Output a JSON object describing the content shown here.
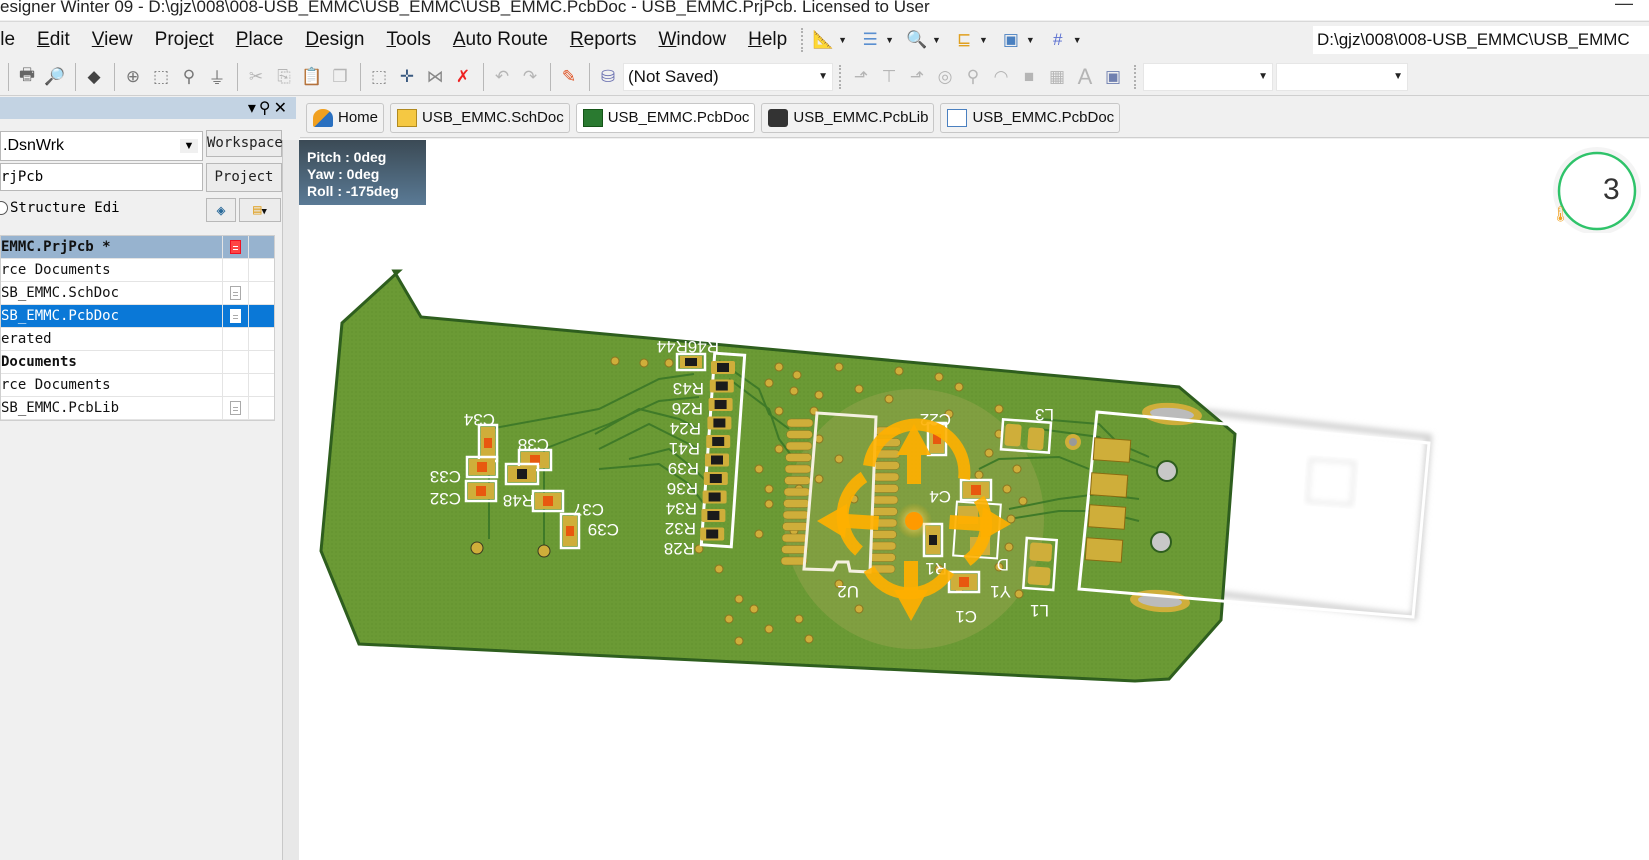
{
  "window": {
    "title": "esigner Winter 09 - D:\\gjz\\008\\008-USB_EMMC\\USB_EMMC\\USB_EMMC.PcbDoc - USB_EMMC.PrjPcb. Licensed to User",
    "minimize_glyph": "—"
  },
  "menu": {
    "items": [
      {
        "label": "ile",
        "underline": ""
      },
      {
        "label": "Edit",
        "underline": "E"
      },
      {
        "label": "View",
        "underline": "V"
      },
      {
        "label": "Project",
        "underline": "c"
      },
      {
        "label": "Place",
        "underline": "P"
      },
      {
        "label": "Design",
        "underline": "D"
      },
      {
        "label": "Tools",
        "underline": "T"
      },
      {
        "label": "Auto Route",
        "underline": "A"
      },
      {
        "label": "Reports",
        "underline": "R"
      },
      {
        "label": "Window",
        "underline": "W"
      },
      {
        "label": "Help",
        "underline": "H"
      }
    ],
    "path": "D:\\gjz\\008\\008-USB_EMMC\\USB_EMMC"
  },
  "toolbar": {
    "view_config": "(Not Saved)",
    "combo_a": "",
    "combo_b": ""
  },
  "panel": {
    "workspace_value": ".DsnWrk",
    "workspace_button": "Workspace",
    "project_value": "rjPcb",
    "project_button": "Project",
    "structure_label": "Structure Edi",
    "tree": [
      {
        "label": "EMMC.PrjPcb *",
        "type": "head",
        "icon": "project-modified"
      },
      {
        "label": "rce Documents",
        "type": "normal",
        "icon": ""
      },
      {
        "label": "SB_EMMC.SchDoc",
        "type": "normal",
        "icon": "document"
      },
      {
        "label": "SB_EMMC.PcbDoc",
        "type": "selected",
        "icon": "document"
      },
      {
        "label": "erated",
        "type": "normal",
        "icon": ""
      },
      {
        "label": " Documents",
        "type": "bold",
        "icon": ""
      },
      {
        "label": "rce Documents",
        "type": "normal",
        "icon": ""
      },
      {
        "label": "SB_EMMC.PcbLib",
        "type": "normal",
        "icon": "document"
      }
    ]
  },
  "tabs": [
    {
      "label": "Home",
      "icon": "home-icon",
      "active": false
    },
    {
      "label": "USB_EMMC.SchDoc",
      "icon": "schematic-icon",
      "active": false
    },
    {
      "label": "USB_EMMC.PcbDoc",
      "icon": "pcb-icon",
      "active": true
    },
    {
      "label": "USB_EMMC.PcbLib",
      "icon": "pcblib-icon",
      "active": false
    },
    {
      "label": "USB_EMMC.PcbDoc",
      "icon": "browser-doc-icon",
      "active": false
    }
  ],
  "view3d": {
    "pitch": "Pitch : 0deg",
    "yaw": "Yaw : 0deg",
    "roll": "Roll : -175deg"
  },
  "gauge": {
    "value_text": "3"
  },
  "pcb": {
    "colors": {
      "board": "#6b9a35",
      "board_edge": "#2e5e1e",
      "pad": "#cfae3a",
      "silk": "#ffffff",
      "nav": "#ffb000"
    },
    "designators": [
      "R46R44",
      "R43",
      "R26",
      "R24",
      "R41",
      "R39",
      "R36",
      "R34",
      "R32",
      "R28",
      "C34",
      "C38",
      "C33",
      "C32",
      "R48",
      "C37",
      "C39",
      "C22",
      "L3",
      "C4",
      "R1",
      "Y1",
      "C1",
      "U2",
      "D",
      "L1"
    ]
  }
}
